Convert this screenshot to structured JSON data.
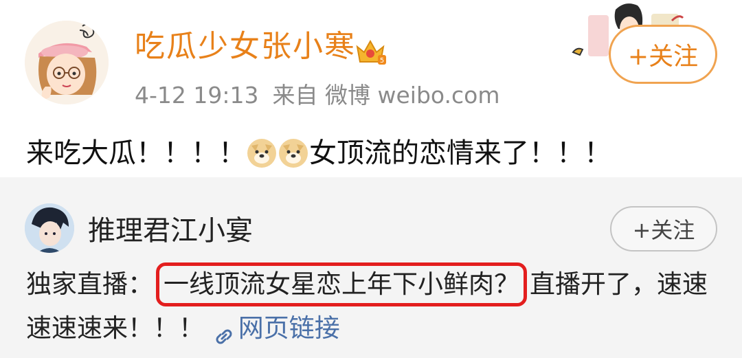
{
  "post": {
    "username": "吃瓜少女张小寒",
    "date": "4-12 19:13",
    "source": "来自 微博 weibo.com",
    "follow_label": "+关注",
    "content_before": "来吃大瓜！！！！",
    "content_after": "女顶流的恋情来了！！！",
    "emoji": "doge"
  },
  "repost": {
    "username": "推理君江小宴",
    "follow_label": "+关注",
    "prefix": "独家直播：",
    "highlight": "一线顶流女星恋上年下小鲜肉？",
    "suffix": "直播开了，速速速速速来！！！",
    "link_label": "网页链接"
  },
  "colors": {
    "username": "#e8811a",
    "highlight_box": "#e31e1e",
    "link": "#4a70a8",
    "repost_bg": "#f4f4f4"
  }
}
